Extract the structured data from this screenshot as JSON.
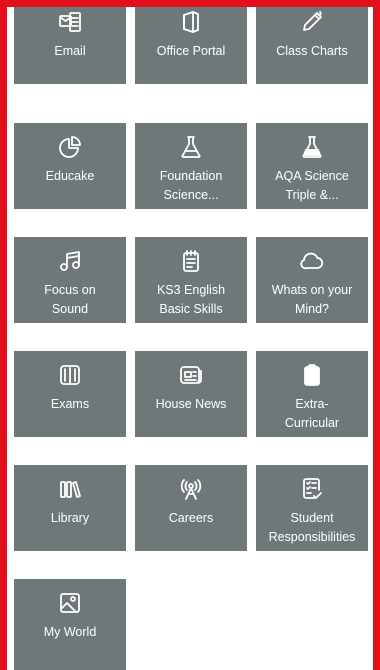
{
  "tiles": [
    {
      "label": "Email",
      "icon": "email-icon"
    },
    {
      "label": "Office Portal",
      "icon": "office-icon"
    },
    {
      "label": "Class Charts",
      "icon": "pen-icon"
    },
    {
      "label": "Educake",
      "icon": "pie-chart-icon"
    },
    {
      "label": "Foundation\nScience...",
      "icon": "flask-icon"
    },
    {
      "label": "AQA Science\nTriple &...",
      "icon": "flask-filled-icon"
    },
    {
      "label": "Focus on\nSound",
      "icon": "music-note-icon"
    },
    {
      "label": "KS3 English\nBasic Skills",
      "icon": "notepad-icon"
    },
    {
      "label": "Whats on your\nMind?",
      "icon": "cloud-icon"
    },
    {
      "label": "Exams",
      "icon": "book-icon"
    },
    {
      "label": "House News",
      "icon": "news-icon"
    },
    {
      "label": "Extra-\nCurricular",
      "icon": "clipboard-icon"
    },
    {
      "label": "Library",
      "icon": "library-icon"
    },
    {
      "label": "Careers",
      "icon": "antenna-icon"
    },
    {
      "label": "Student\nResponsibilities",
      "icon": "checklist-icon"
    },
    {
      "label": "My World",
      "icon": "image-icon"
    }
  ],
  "colors": {
    "border": "#e3101c",
    "tile": "#6f7879",
    "text": "#ffffff"
  }
}
